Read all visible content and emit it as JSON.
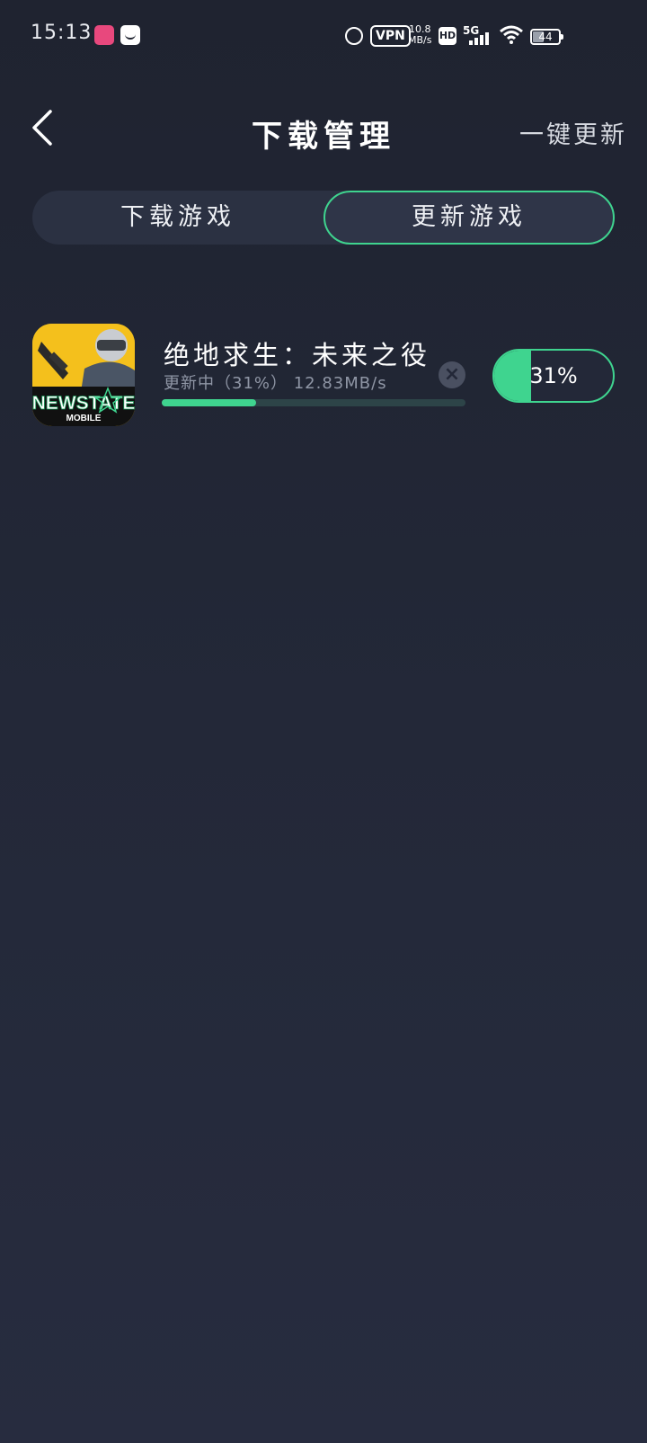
{
  "status_bar": {
    "time": "15:13",
    "vpn": "VPN",
    "net_speed_value": "10.8",
    "net_speed_unit": "MB/s",
    "hd": "HD",
    "network": "5G",
    "battery": "44"
  },
  "header": {
    "title": "下载管理",
    "update_all": "一键更新"
  },
  "tabs": [
    {
      "label": "下载游戏",
      "active": false
    },
    {
      "label": "更新游戏",
      "active": true
    }
  ],
  "game": {
    "icon_text_main": "NEWSTATE",
    "icon_text_sub": "MOBILE",
    "title": "绝地求生：未来之役",
    "status": "更新中（31%） 12.83MB/s",
    "progress": 0.31,
    "percent_label": "31%"
  },
  "colors": {
    "accent": "#3fd48f",
    "background": "#232838",
    "track": "#2d4448"
  }
}
